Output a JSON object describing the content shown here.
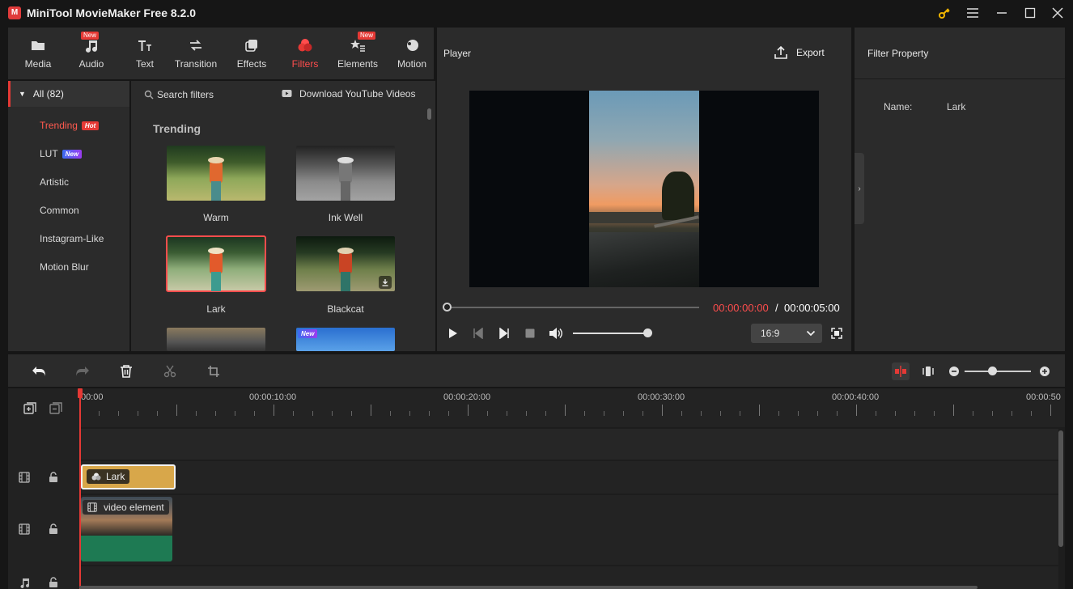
{
  "app": {
    "title": "MiniTool MovieMaker Free 8.2.0",
    "logo_letter": "M"
  },
  "toolbar": {
    "items": [
      {
        "label": "Media",
        "icon": "folder-icon",
        "new": false
      },
      {
        "label": "Audio",
        "icon": "music-note-icon",
        "new": true
      },
      {
        "label": "Text",
        "icon": "text-icon",
        "new": false
      },
      {
        "label": "Transition",
        "icon": "transition-arrows-icon",
        "new": false
      },
      {
        "label": "Effects",
        "icon": "effects-layers-icon",
        "new": false
      },
      {
        "label": "Filters",
        "icon": "filters-circles-icon",
        "new": false,
        "active": true
      },
      {
        "label": "Elements",
        "icon": "elements-icon",
        "new": true
      },
      {
        "label": "Motion",
        "icon": "motion-icon",
        "new": false
      }
    ],
    "new_badge": "New"
  },
  "leftnav": {
    "all_label": "All (82)",
    "items": [
      {
        "label": "Trending",
        "badge": "Hot",
        "active": true
      },
      {
        "label": "LUT",
        "badge": "New"
      },
      {
        "label": "Artistic"
      },
      {
        "label": "Common"
      },
      {
        "label": "Instagram-Like"
      },
      {
        "label": "Motion Blur"
      }
    ]
  },
  "filters": {
    "search_placeholder": "Search filters",
    "download_label": "Download YouTube Videos",
    "section_title": "Trending",
    "items": [
      {
        "label": "Warm",
        "selected": false
      },
      {
        "label": "Ink Well",
        "selected": false
      },
      {
        "label": "Lark",
        "selected": true
      },
      {
        "label": "Blackcat",
        "selected": false,
        "download": true
      }
    ],
    "partial_new_badge": "New"
  },
  "player": {
    "title": "Player",
    "export_label": "Export",
    "time_current": "00:00:00:00",
    "time_separator": "/",
    "time_total": "00:00:05:00",
    "aspect_ratio": "16:9",
    "progress": 0,
    "volume": 1.0
  },
  "filter_property": {
    "title": "Filter Property",
    "name_label": "Name:",
    "name_value": "Lark"
  },
  "timeline": {
    "ruler_labels": [
      "00:00",
      "00:00:10:00",
      "00:00:20:00",
      "00:00:30:00",
      "00:00:40:00",
      "00:00:50"
    ],
    "filter_clip_label": "Lark",
    "video_clip_label": "video element",
    "zoom_level": 0.45
  },
  "colors": {
    "accent": "#e53935",
    "clip_filter": "#d8a74a",
    "clip_audio": "#1e7a53",
    "panel": "#2b2b2b"
  }
}
